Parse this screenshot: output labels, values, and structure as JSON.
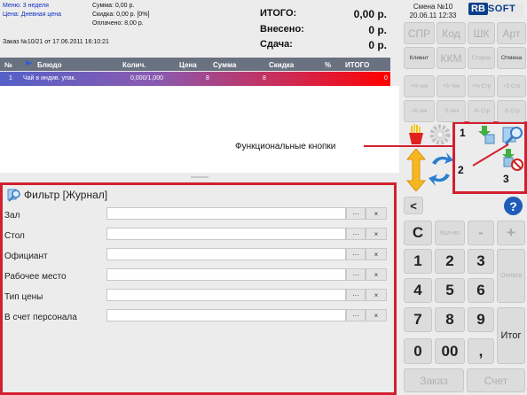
{
  "header": {
    "menu": "Меню: 3 неделя",
    "price": "Цена: Дневная цена",
    "sum": "Сумма: 0,00 р.",
    "discount": "Скидка: 0,00 р. [0%]",
    "paid": "Оплачено: 8,00 р.",
    "order": "Заказ №10/21 от 17.06.2011 16:10:21",
    "totals": [
      {
        "label": "ИТОГО:",
        "value": "0,00 р."
      },
      {
        "label": "Внесено:",
        "value": "0 р."
      },
      {
        "label": "Сдача:",
        "value": "0 р."
      }
    ],
    "shift": "Смена №10",
    "datetime": "20.06.11 12:33",
    "logo_rb": "RB",
    "logo_soft": "SOFT"
  },
  "grid": {
    "columns": [
      "№",
      "Блюдо",
      "Колич.",
      "Цена",
      "Сумма",
      "Скидка",
      "%",
      "ИТОГО"
    ],
    "row": {
      "n": "1",
      "dish": "Чай в индив. упак.",
      "qty": "0,000/1,000",
      "price": "8",
      "sum": "8",
      "total": "0"
    }
  },
  "keys": {
    "row1": [
      "СПР",
      "Код",
      "ШК",
      "Арт"
    ],
    "row2": [
      "Клиент",
      "ККМ",
      "Сторно",
      "Отмена"
    ],
    "row3": [
      "+% чек",
      "+S Чек",
      "+% Стр",
      "+S Стр"
    ],
    "row4": [
      "-% чек",
      "-S Чек",
      "-% Стр",
      "-S Стр"
    ],
    "back": "<",
    "help": "?",
    "c": "C",
    "qty": "Кол-во",
    "minus": "-",
    "plus": "+",
    "digits": [
      "1",
      "2",
      "3",
      "4",
      "5",
      "6",
      "7",
      "8",
      "9",
      "0",
      "00",
      ","
    ],
    "pay": "Оплата",
    "total": "Итог",
    "order": "Заказ",
    "check": "Счет"
  },
  "callouts": {
    "func": "Функциональные кнопки",
    "n1": "1",
    "n2": "2",
    "n3": "3"
  },
  "filter": {
    "title": "Фильтр [Журнал]",
    "fields": [
      "Зал",
      "Стол",
      "Официант",
      "Рабочее место",
      "Тип цены",
      "В счет персонала"
    ],
    "dots": "···",
    "clear": "×"
  },
  "colors": {
    "accent_red": "#d32030",
    "logo_blue": "#0a3e8a",
    "grid_header": "#6a7180"
  }
}
